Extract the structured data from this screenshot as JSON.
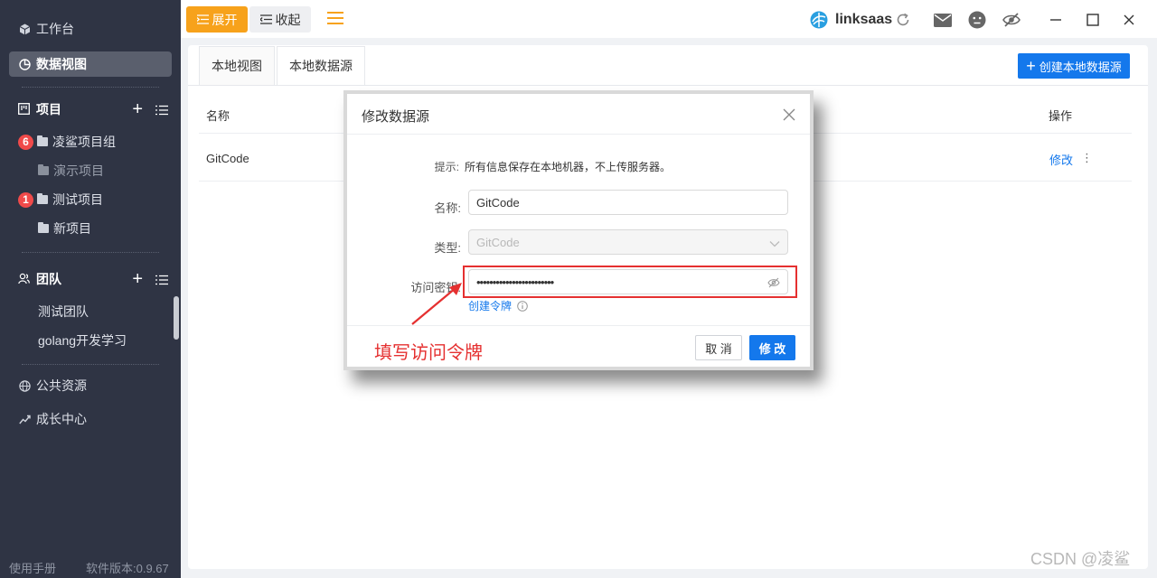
{
  "sidebar": {
    "workbench": "工作台",
    "data_view": "数据视图",
    "projects_header": "项目",
    "project_group": {
      "label": "凌鲨项目组",
      "badge": "6"
    },
    "demo_project": "演示项目",
    "test_project": {
      "label": "测试项目",
      "badge": "1"
    },
    "new_project": "新项目",
    "team_header": "团队",
    "team_test": "测试团队",
    "team_golang": "golang开发学习",
    "public_resources": "公共资源",
    "growth_center": "成长中心",
    "manual": "使用手册",
    "version": "软件版本:0.9.67"
  },
  "topbar": {
    "expand": "展开",
    "collapse": "收起",
    "brand": "linksaas"
  },
  "tabs": [
    "本地视图",
    "本地数据源"
  ],
  "create_button": "创建本地数据源",
  "table": {
    "headers": {
      "name": "名称",
      "ops": "操作"
    },
    "rows": [
      {
        "name": "GitCode",
        "edit": "修改",
        "more": "⋮"
      }
    ]
  },
  "modal": {
    "title": "修改数据源",
    "hint_label": "提示:",
    "hint_text": "所有信息保存在本地机器，不上传服务器。",
    "name_label": "名称:",
    "name_value": "GitCode",
    "type_label": "类型:",
    "type_value": "GitCode",
    "key_label": "访问密钥:",
    "key_value": "••••••••••••••••••••••••",
    "create_token": "创建令牌",
    "cancel": "取 消",
    "ok": "修 改"
  },
  "annotation": "填写访问令牌",
  "watermark": "CSDN @凌鲨",
  "colors": {
    "accent": "#1478ec",
    "sidebar": "#2f3444",
    "orange": "#f7a21b",
    "annotation_red": "#e53030"
  }
}
